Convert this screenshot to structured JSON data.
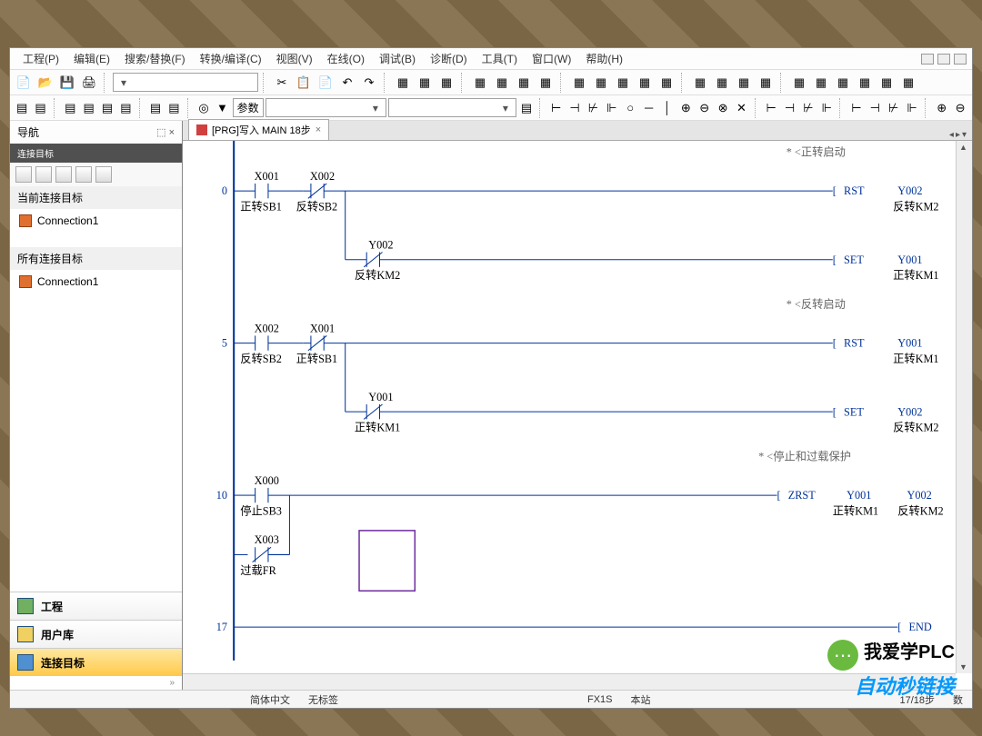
{
  "menu": {
    "project": "工程(P)",
    "edit": "编辑(E)",
    "search": "搜索/替换(F)",
    "convert": "转换/编译(C)",
    "view": "视图(V)",
    "online": "在线(O)",
    "debug": "调试(B)",
    "diagnose": "诊断(D)",
    "tools": "工具(T)",
    "window": "窗口(W)",
    "help": "帮助(H)"
  },
  "combo": {
    "param": "参数"
  },
  "nav": {
    "title": "导航",
    "close": "⬚ ×",
    "dark": "连接目标",
    "grp1": "当前连接目标",
    "conn": "Connection1",
    "grp2": "所有连接目标"
  },
  "navtabs": {
    "project": "工程",
    "userlib": "用户库",
    "conn": "连接目标"
  },
  "tab": {
    "title": "[PRG]写入 MAIN 18步"
  },
  "ladder": {
    "comments": {
      "c1": "* <正转启动",
      "c2": "* <反转启动",
      "c3": "* <停止和过载保护"
    },
    "steps": {
      "s0": "0",
      "s5": "5",
      "s10": "10",
      "s17": "17"
    },
    "r0": {
      "x001": "X001",
      "x001l": "正转SB1",
      "x002": "X002",
      "x002l": "反转SB2",
      "rst": "RST",
      "y002": "Y002",
      "y002l": "反转KM2",
      "br_y002": "Y002",
      "br_y002l": "反转KM2",
      "set": "SET",
      "y001": "Y001",
      "y001l": "正转KM1"
    },
    "r5": {
      "x002": "X002",
      "x002l": "反转SB2",
      "x001": "X001",
      "x001l": "正转SB1",
      "rst": "RST",
      "y001": "Y001",
      "y001l": "正转KM1",
      "br_y001": "Y001",
      "br_y001l": "正转KM1",
      "set": "SET",
      "y002": "Y002",
      "y002l": "反转KM2"
    },
    "r10": {
      "x000": "X000",
      "x000l": "停止SB3",
      "zrst": "ZRST",
      "y001": "Y001",
      "y001l": "正转KM1",
      "y002": "Y002",
      "y002l": "反转KM2",
      "x003": "X003",
      "x003l": "过载FR"
    },
    "r17": {
      "end": "END"
    }
  },
  "status": {
    "lang": "简体中文",
    "label": "无标签",
    "plc": "FX1S",
    "station": "本站",
    "step": "17/18步",
    "num": "数"
  },
  "watermark": {
    "line1": "我爱学PLC",
    "line2": "自动秒链接"
  }
}
